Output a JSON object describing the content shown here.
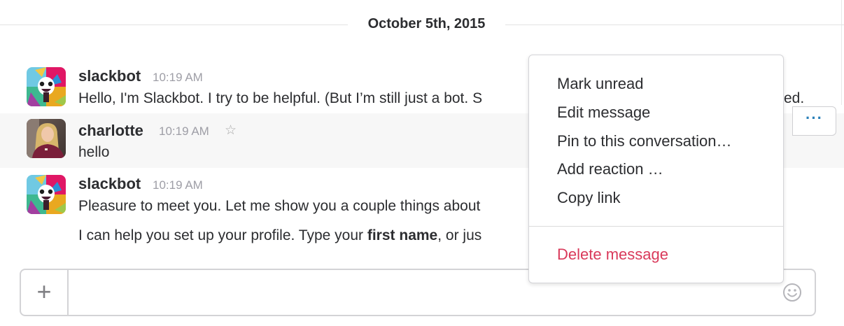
{
  "day_divider": {
    "label": "October 5th, 2015"
  },
  "messages": [
    {
      "sender": "slackbot",
      "time": "10:19 AM",
      "lines": [
        "Hello, I'm Slackbot. I try to be helpful. (But I’m still just a bot. S",
        "ed."
      ]
    },
    {
      "sender": "charlotte",
      "time": "10:19 AM",
      "star_icon": "star-outline-icon",
      "lines": [
        "hello"
      ]
    },
    {
      "sender": "slackbot",
      "time": "10:19 AM",
      "lines": [
        "Pleasure to meet you. Let me show you a couple things about",
        {
          "before": "I can help you set up your profile. Type your ",
          "bold": "first name",
          "after": ", or jus"
        }
      ]
    }
  ],
  "message_actions": {
    "icon": "more-actions-icon",
    "label": "···"
  },
  "context_menu": {
    "items": [
      {
        "label": "Mark unread"
      },
      {
        "label": "Edit message"
      },
      {
        "label": "Pin to this conversation…"
      },
      {
        "label": "Add reaction …"
      },
      {
        "label": "Copy link"
      }
    ],
    "danger_item": {
      "label": "Delete message",
      "color": "#d9395a"
    }
  },
  "composer": {
    "plus_icon": "plus-icon",
    "plus_label": "+",
    "value": "",
    "placeholder": "",
    "emoji_icon": "smiley-icon"
  },
  "colors": {
    "link_blue": "#2a80b9",
    "text": "#2c2d30",
    "timestamp": "#9e9ea6",
    "hover_bg": "#f7f7f7"
  }
}
